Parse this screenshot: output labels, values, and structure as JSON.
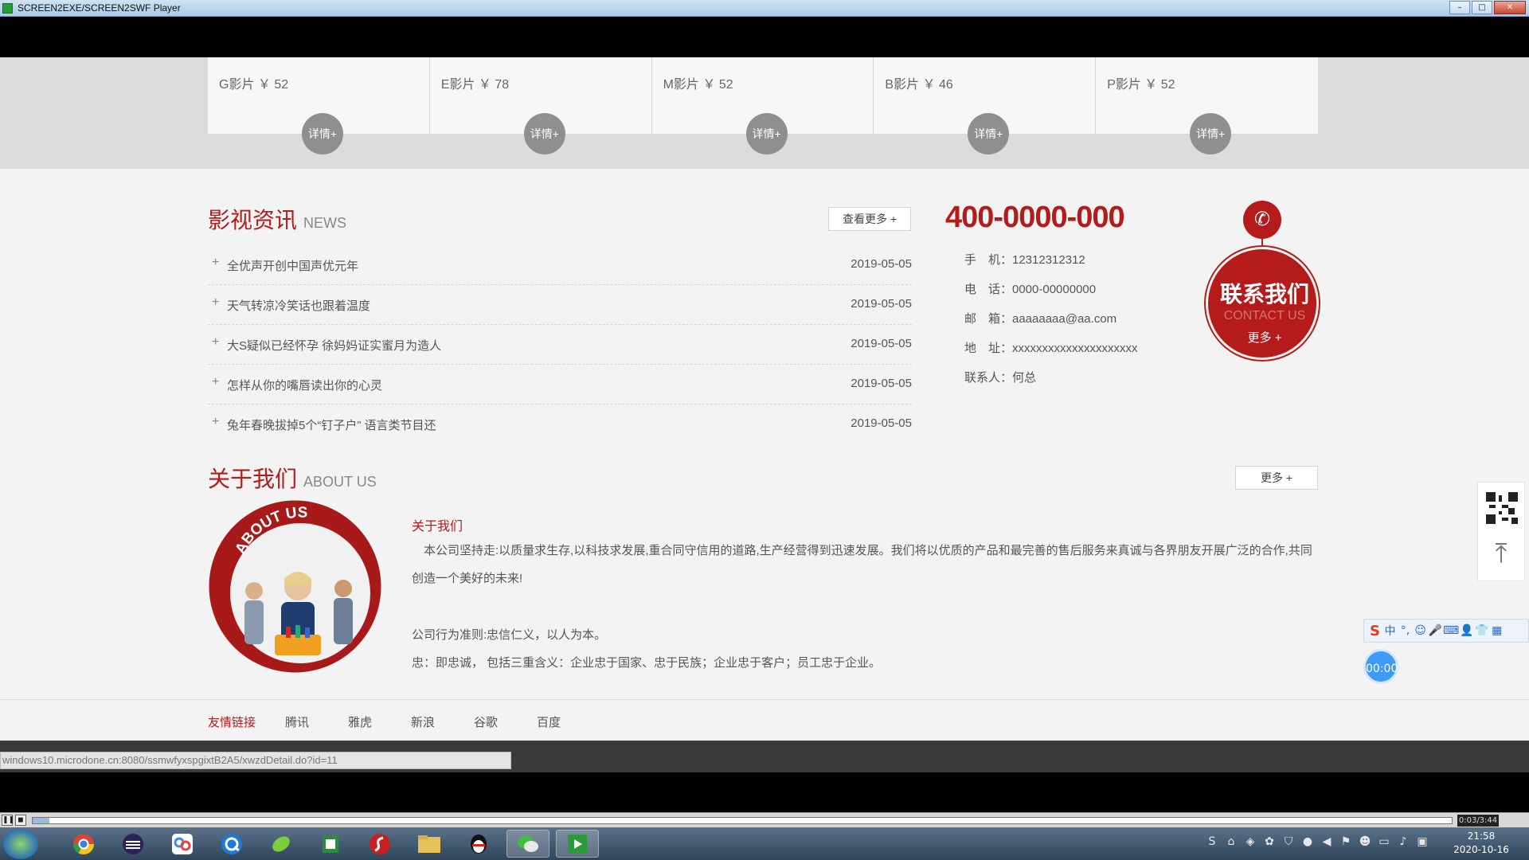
{
  "window": {
    "title": "SCREEN2EXE/SCREEN2SWF Player",
    "min": "–",
    "max": "□",
    "close": "✕"
  },
  "products": [
    {
      "name": "G影片 ￥ 52",
      "detail": "详情+"
    },
    {
      "name": "E影片 ￥ 78",
      "detail": "详情+"
    },
    {
      "name": "M影片 ￥ 52",
      "detail": "详情+"
    },
    {
      "name": "B影片 ￥ 46",
      "detail": "详情+"
    },
    {
      "name": "P影片 ￥ 52",
      "detail": "详情+"
    }
  ],
  "news": {
    "title": "影视资讯",
    "title_en": "NEWS",
    "more": "查看更多 +",
    "items": [
      {
        "title": "全优声开创中国声优元年",
        "date": "2019-05-05"
      },
      {
        "title": "天气转凉冷笑话也跟着温度",
        "date": "2019-05-05"
      },
      {
        "title": "大S疑似已经怀孕 徐妈妈证实蜜月为造人",
        "date": "2019-05-05"
      },
      {
        "title": "怎样从你的嘴唇读出你的心灵",
        "date": "2019-05-05"
      },
      {
        "title": "兔年春晚拔掉5个“钉子户” 语言类节目还",
        "date": "2019-05-05"
      }
    ]
  },
  "contact": {
    "phone": "400-0000-000",
    "lines": [
      "手　机：12312312312",
      "电　话：0000-00000000",
      "邮　箱：aaaaaaaa@aa.com",
      "地　址：xxxxxxxxxxxxxxxxxxxxx",
      "联系人：何总"
    ],
    "badge_cn": "联系我们",
    "badge_en": "CONTACT US",
    "badge_more": "更多 +"
  },
  "about": {
    "title": "关于我们",
    "title_en": "ABOUT US",
    "more": "更多 +",
    "image_text": "ABOUT US",
    "subtitle": "关于我们",
    "p1": "　本公司坚持走:以质量求生存,以科技求发展,重合同守信用的道路,生产经营得到迅速发展。我们将以优质的产品和最完善的售后服务来真诚与各界朋友开展广泛的合作,共同创造一个美好的未来!",
    "p2": "公司行为准则:忠信仁义，以人为本。",
    "p3": "忠：即忠诚， 包括三重含义：企业忠于国家、忠于民族；企业忠于客户；员工忠于企业。"
  },
  "friends": {
    "label": "友情链接",
    "links": [
      "腾讯",
      "雅虎",
      "新浪",
      "谷歌",
      "百度"
    ]
  },
  "status_url": "windows10.microdone.cn:8080/ssmwfyxspgixtB2A5/xwzdDetail.do?id=11",
  "side": {
    "ime": [
      "S",
      "中",
      "°,",
      "☺",
      "🎤",
      "⌨",
      "👤",
      "👕",
      "▦"
    ],
    "timer": "00:00"
  },
  "player": {
    "pause": "❚❚",
    "stop": "◼",
    "time": "0:03/3:44",
    "progress": 0.012
  },
  "taskbar": {
    "apps": [
      "chrome-icon",
      "ide-icon",
      "baidu-netdisk-icon",
      "browser-q-icon",
      "leaf-icon",
      "excel-icon",
      "flash-icon",
      "folder-icon",
      "qq-icon",
      "wechat-icon",
      "player-icon"
    ],
    "clock_time": "21:58",
    "clock_date": "2020-10-16"
  }
}
